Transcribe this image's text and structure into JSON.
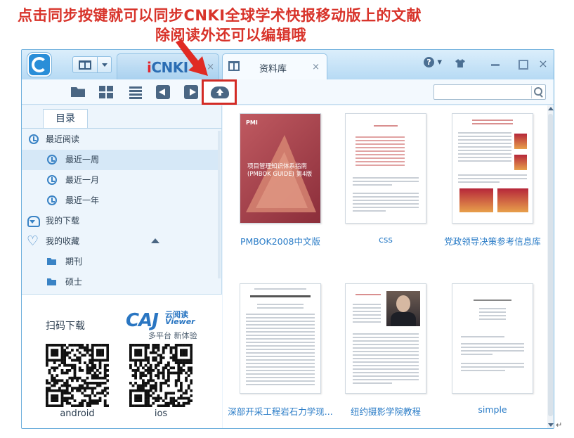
{
  "caption": {
    "line1": "点击同步按键就可以同步CNKI全球学术快报移动版上的文献",
    "line2": "除阅读外还可以编辑哦"
  },
  "colors": {
    "caption": "#d8332a",
    "accent": "#2a8ed8",
    "highlight_box": "#d32b25",
    "link": "#2a7cc7"
  },
  "titlebar": {
    "app_icon": "cajviewer-logo-icon",
    "menu_icon": "library-book-icon",
    "tabs": [
      {
        "logo_i": "i",
        "logo_rest": "CNKI",
        "close": "×"
      },
      {
        "title": "资料库",
        "close": "×"
      }
    ],
    "help_symbol": "?",
    "help_caret": "▾",
    "close_symbol": "×"
  },
  "toolbar": {
    "icons": [
      "folder-open-icon",
      "grid-view-icon",
      "list-view-icon",
      "back-icon",
      "forward-icon",
      "cloud-sync-icon"
    ],
    "search": {
      "value": "",
      "placeholder": ""
    }
  },
  "sidebar": {
    "tab_label": "目录",
    "items": [
      {
        "label": "最近阅读",
        "icon": "clock-icon"
      },
      {
        "label": "最近一周",
        "icon": "clock-icon",
        "selected": true
      },
      {
        "label": "最近一月",
        "icon": "clock-icon"
      },
      {
        "label": "最近一年",
        "icon": "clock-icon"
      },
      {
        "label": "我的下载",
        "icon": "download-icon"
      },
      {
        "label": "我的收藏",
        "icon": "heart-icon"
      },
      {
        "label": "期刊",
        "icon": "folder-icon"
      },
      {
        "label": "硕士",
        "icon": "folder-icon"
      }
    ]
  },
  "qr_panel": {
    "title": "扫码下载",
    "caj": {
      "logo": "CAJ",
      "cn_name": "云阅读",
      "viewer": "Viewer",
      "subtitle": "多平台 新体验"
    },
    "android_label": "android",
    "ios_label": "ios"
  },
  "documents": [
    {
      "title": "PMBOK2008中文版",
      "cover_title_1": "项目管理知识体系指南",
      "cover_title_2": "(PMBOK GUIDE) 第4版",
      "cover_brand": "PMI"
    },
    {
      "title": "css"
    },
    {
      "title": "党政领导决策参考信息库"
    },
    {
      "title": "深部开采工程岩石力学现..."
    },
    {
      "title": "纽约摄影学院教程"
    },
    {
      "title": "simple"
    }
  ],
  "misc": {
    "return_mark": "↵"
  }
}
